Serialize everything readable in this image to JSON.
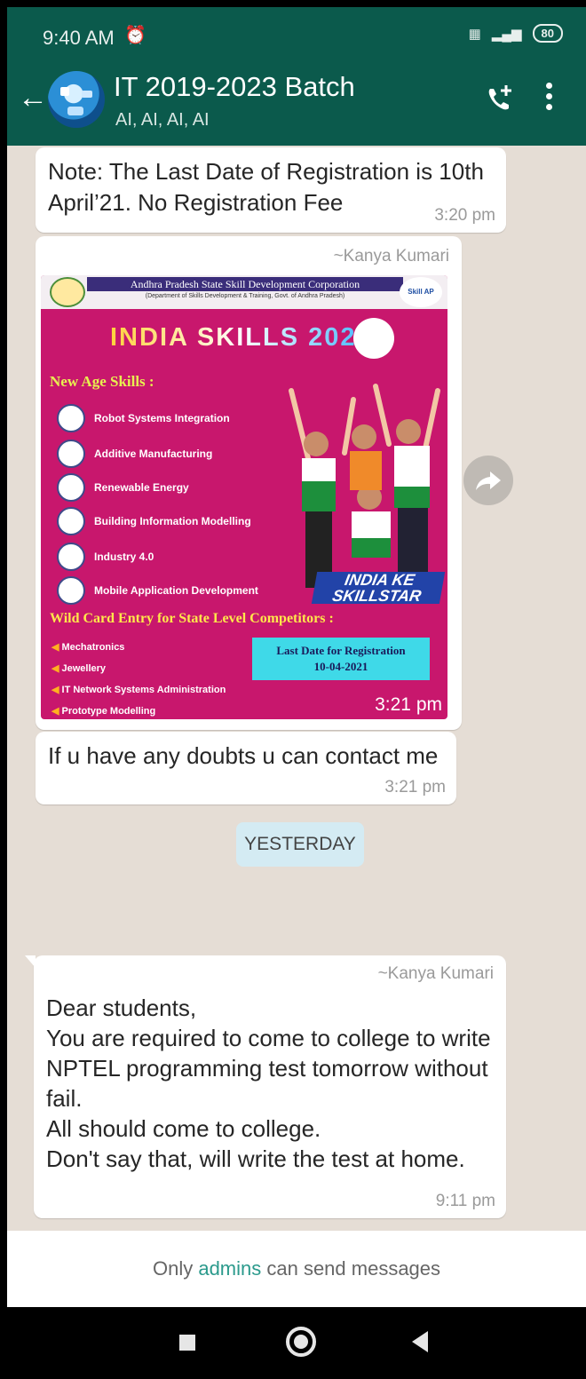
{
  "status_bar": {
    "time": "9:40 AM",
    "battery": "80"
  },
  "header": {
    "title": "IT 2019-2023 Batch",
    "subtitle": "AI, AI, AI, AI"
  },
  "messages": [
    {
      "text": "Note: The Last Date of Registration is 10th April’21. No Registration Fee",
      "time": "3:20 pm"
    },
    {
      "sender": "~Kanya Kumari",
      "type": "image",
      "time": "3:21 pm"
    },
    {
      "text": "If u have any doubts u can contact me",
      "time": "3:21 pm"
    },
    {
      "sender": "~Kanya Kumari",
      "lines": [
        "Dear students,",
        "You are required to come to college to write NPTEL programming test tomorrow without fail.",
        "All should come to college.",
        "Don't say that, will write the test at home."
      ],
      "time": "9:11 pm"
    }
  ],
  "date_divider": "YESTERDAY",
  "poster": {
    "org": "Andhra Pradesh State Skill Development Corporation",
    "dept": "(Department of Skills Development & Training, Govt. of Andhra Pradesh)",
    "ap_logo": "Skill AP",
    "title": "INDIA SKILLS 2021",
    "new_age": "New Age Skills :",
    "skills": [
      "Robot Systems Integration",
      "Additive Manufacturing",
      "Renewable Energy",
      "Building Information Modelling",
      "Industry 4.0",
      "Mobile Application Development"
    ],
    "wild_card": "Wild Card Entry for State Level Competitors :",
    "wild_items": [
      "Mechatronics",
      "Jewellery",
      "IT Network Systems Administration",
      "Prototype Modelling"
    ],
    "last_date_label": "Last Date for Registration",
    "last_date": "10-04-2021",
    "slogan_top": "INDIA KE",
    "slogan_bottom": "SKILLSTAR"
  },
  "footer": {
    "prefix": "Only ",
    "link": "admins",
    "suffix": " can send messages"
  },
  "colors": {
    "header": "#0b5a4c",
    "chat_bg": "#e5ddd5",
    "link": "#2b9a8c",
    "poster_bg": "#c8176d"
  }
}
